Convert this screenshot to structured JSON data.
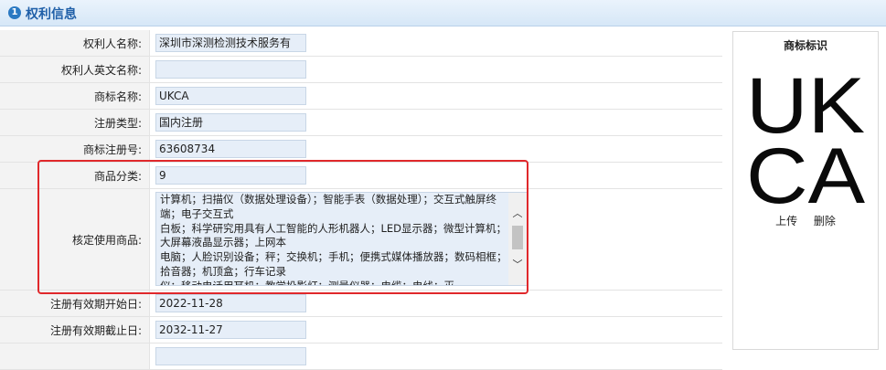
{
  "section": {
    "number": "1",
    "title": "权利信息"
  },
  "fields": {
    "owner_name": {
      "label": "权利人名称:",
      "value": "深圳市深测检测技术服务有"
    },
    "owner_english_name": {
      "label": "权利人英文名称:",
      "value": ""
    },
    "trademark_name": {
      "label": "商标名称:",
      "value": "UKCA"
    },
    "registration_type": {
      "label": "注册类型:",
      "value": "国内注册"
    },
    "registration_number": {
      "label": "商标注册号:",
      "value": "63608734"
    },
    "goods_class": {
      "label": "商品分类:",
      "value": "9"
    },
    "approved_goods": {
      "label": "核定使用商品:",
      "value": "计算机；扫描仪（数据处理设备）；智能手表（数据处理）；交互式触屏终端；电子交互式\n白板；科学研究用具有人工智能的人形机器人；LED显示器；微型计算机；大屏幕液晶显示器；上网本\n电脑；人脸识别设备；秤；交换机；手机；便携式媒体播放器；数码相框；拾音器；机顶盒；行车记录\n仪；移动电话用耳机；教学投影灯；测量仪器；电缆；电线；灭"
    },
    "valid_start": {
      "label": "注册有效期开始日:",
      "value": "2022-11-28"
    },
    "valid_end": {
      "label": "注册有效期截止日:",
      "value": "2032-11-27"
    }
  },
  "trademark_panel": {
    "title": "商标标识",
    "logo_line1": "UK",
    "logo_line2": "CA",
    "upload_label": "上传",
    "delete_label": "删除"
  },
  "colors": {
    "highlight": "#e0282b",
    "accent": "#2a79c2"
  }
}
